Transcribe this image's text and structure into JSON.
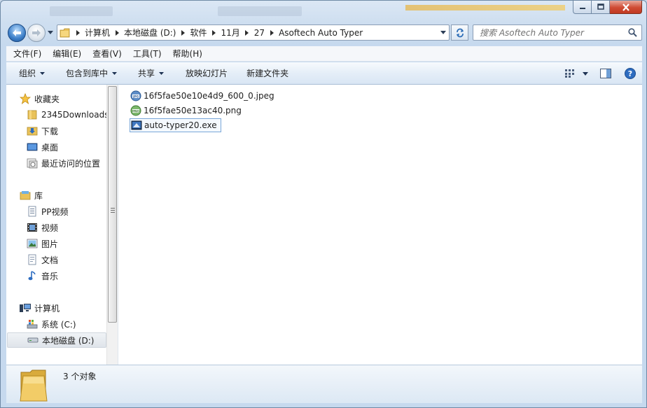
{
  "window": {
    "caption": {
      "minimize": "minimize",
      "maximize": "maximize",
      "close": "close"
    }
  },
  "nav": {
    "breadcrumbs": [
      "计算机",
      "本地磁盘 (D:)",
      "软件",
      "11月",
      "27",
      "Asoftech Auto Typer"
    ],
    "search_placeholder": "搜索 Asoftech Auto Typer"
  },
  "menubar": {
    "items": [
      {
        "label": "文件(F)"
      },
      {
        "label": "编辑(E)"
      },
      {
        "label": "查看(V)"
      },
      {
        "label": "工具(T)"
      },
      {
        "label": "帮助(H)"
      }
    ]
  },
  "commandbar": {
    "organize": "组织",
    "include_in_library": "包含到库中",
    "share": "共享",
    "slideshow": "放映幻灯片",
    "new_folder": "新建文件夹"
  },
  "sidebar": {
    "favorites": {
      "label": "收藏夹",
      "items": [
        {
          "label": "2345Downloads",
          "icon": "folder-icon"
        },
        {
          "label": "下载",
          "icon": "download-folder-icon"
        },
        {
          "label": "桌面",
          "icon": "desktop-icon"
        },
        {
          "label": "最近访问的位置",
          "icon": "recent-places-icon"
        }
      ]
    },
    "libraries": {
      "label": "库",
      "items": [
        {
          "label": "PP视频",
          "icon": "library-doc-icon"
        },
        {
          "label": "视频",
          "icon": "video-icon"
        },
        {
          "label": "图片",
          "icon": "pictures-icon"
        },
        {
          "label": "文档",
          "icon": "documents-icon"
        },
        {
          "label": "音乐",
          "icon": "music-icon"
        }
      ]
    },
    "computer": {
      "label": "计算机",
      "items": [
        {
          "label": "系统 (C:)",
          "icon": "system-drive-icon"
        },
        {
          "label": "本地磁盘 (D:)",
          "icon": "drive-icon",
          "selected": true
        }
      ]
    }
  },
  "files": [
    {
      "name": "16f5fae50e10e4d9_600_0.jpeg",
      "icon": "jpeg-file-icon"
    },
    {
      "name": "16f5fae50e13ac40.png",
      "icon": "png-file-icon"
    },
    {
      "name": "auto-typer20.exe",
      "icon": "exe-file-icon",
      "focused": true
    }
  ],
  "details": {
    "count_text": "3 个对象"
  },
  "colors": {
    "chrome": "#c9d8ea",
    "selection_border": "#7aa7d8",
    "close_button": "#c13a22"
  }
}
